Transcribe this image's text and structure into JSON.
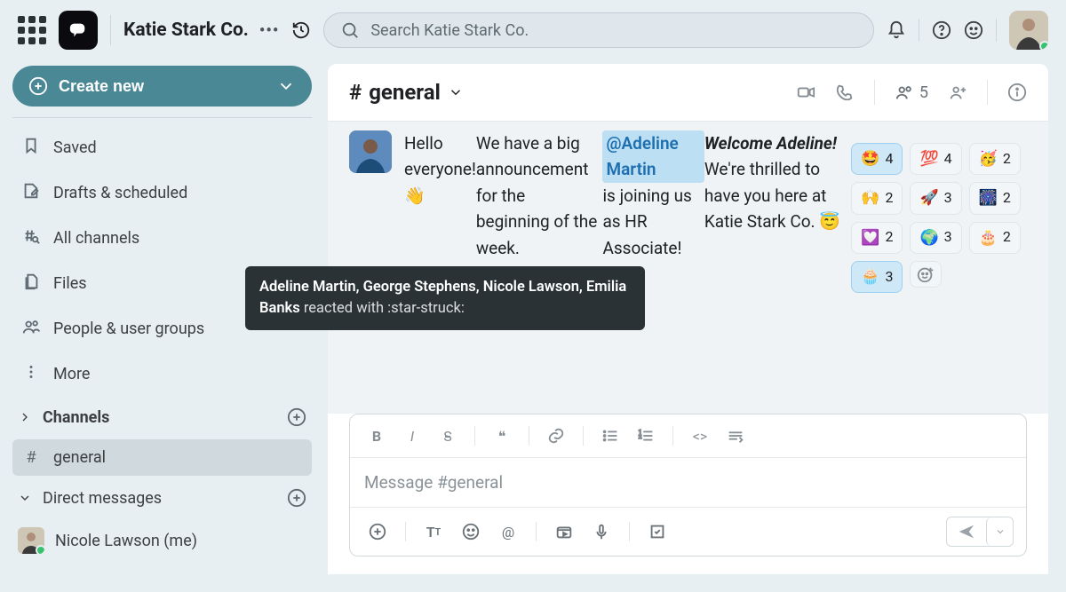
{
  "header": {
    "orgName": "Katie Stark Co.",
    "searchPlaceholder": "Search Katie Stark Co."
  },
  "sidebar": {
    "createLabel": "Create new",
    "items": [
      {
        "label": "Saved"
      },
      {
        "label": "Drafts & scheduled"
      },
      {
        "label": "All channels"
      },
      {
        "label": "Files"
      },
      {
        "label": "People & user groups"
      },
      {
        "label": "More"
      }
    ],
    "channelsSection": "Channels",
    "channels": [
      {
        "label": "general"
      }
    ],
    "dmSection": "Direct messages",
    "dms": [
      {
        "label": "Nicole Lawson (me)"
      }
    ]
  },
  "chat": {
    "channelPrefix": "#",
    "channelName": "general",
    "memberCount": "5",
    "message": {
      "line1": "Hello everyone! 👋",
      "line2": "We have a big announcement for the beginning of the week.",
      "mention": "@Adeline Martin",
      "line3rest": " is joining us as HR Associate!",
      "welcome_pre": "Welcome Adeline!",
      "welcome_post": " We're thrilled to have you here at Katie Stark Co. 😇"
    },
    "reactions": [
      {
        "emoji": "🤩",
        "count": "4",
        "mine": true
      },
      {
        "emoji": "💯",
        "count": "4"
      },
      {
        "emoji": "🥳",
        "count": "2"
      },
      {
        "emoji": "🙌",
        "count": "2"
      },
      {
        "emoji": "🚀",
        "count": "3"
      },
      {
        "emoji": "🎆",
        "count": "2"
      },
      {
        "emoji": "💟",
        "count": "2"
      },
      {
        "emoji": "🌍",
        "count": "3"
      },
      {
        "emoji": "🎂",
        "count": "2"
      },
      {
        "emoji": "🧁",
        "count": "3",
        "mine": true
      }
    ],
    "composerPlaceholder": "Message #general"
  },
  "tooltip": {
    "names": "Adeline Martin, George Stephens, Nicole Lawson, Emilia Banks",
    "rest": " reacted with :star-struck:"
  }
}
